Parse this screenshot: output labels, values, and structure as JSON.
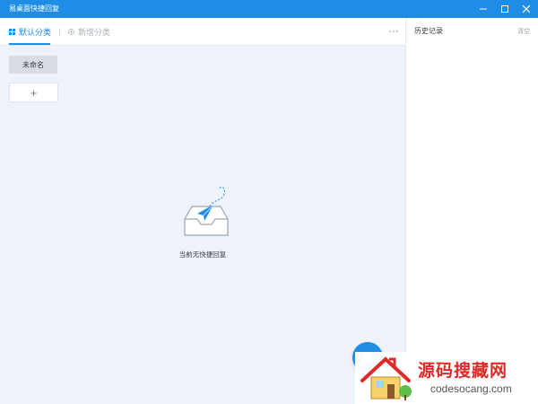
{
  "window": {
    "title": "易桌面快捷回复",
    "controls": {
      "minimize": "minimize",
      "maximize": "maximize",
      "close": "close"
    }
  },
  "tabs": {
    "default_label": "默认分类",
    "new_label": "新增分类",
    "more_label": "···"
  },
  "categories": {
    "items": [
      {
        "label": "未命名"
      }
    ],
    "add_label": "+"
  },
  "empty_state": {
    "message": "当前无快捷回复"
  },
  "history": {
    "title": "历史记录",
    "clear_label": "清空"
  },
  "watermark": {
    "brand": "源码搜藏网",
    "domain": "codesocang.com"
  },
  "colors": {
    "accent": "#1f8ce6",
    "content_bg": "#eef3fb",
    "category_bg": "#d9dde3",
    "watermark_red": "#e02a2a"
  },
  "icons": {
    "default_tab": "grid-icon",
    "new_tab": "plus-circle-icon",
    "empty": "inbox-paper-plane-icon",
    "fab": "add-reply-icon"
  }
}
